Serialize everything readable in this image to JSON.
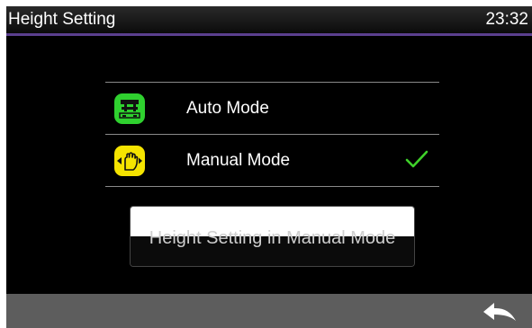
{
  "header": {
    "title": "Height Setting",
    "time": "23:32"
  },
  "modes": [
    {
      "label": "Auto Mode",
      "icon": "auto-mode-icon",
      "icon_color": "#2fd12f",
      "selected": false
    },
    {
      "label": "Manual Mode",
      "icon": "manual-mode-icon",
      "icon_color": "#f5e400",
      "selected": true
    }
  ],
  "action_button": {
    "label": "Height Setting in Manual Mode"
  },
  "footer": {
    "back_icon": "back-arrow-icon"
  },
  "colors": {
    "accent": "#5b3f8f",
    "check": "#3fd12a",
    "footer": "#5d5d5d"
  }
}
